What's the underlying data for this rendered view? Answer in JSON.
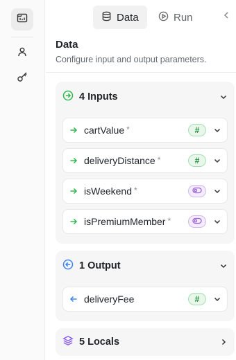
{
  "rail": {
    "items": [
      {
        "icon": "workflow-icon"
      },
      {
        "icon": "user-icon"
      },
      {
        "icon": "key-icon"
      }
    ]
  },
  "tabs": [
    {
      "label": "Data",
      "icon": "database-icon",
      "active": true
    },
    {
      "label": "Run",
      "icon": "play-icon",
      "active": false
    }
  ],
  "section": {
    "title": "Data",
    "description": "Configure input and output parameters."
  },
  "inputs": {
    "header": "4 Inputs",
    "items": [
      {
        "name": "cartValue",
        "required": "*",
        "type": "number"
      },
      {
        "name": "deliveryDistance",
        "required": "*",
        "type": "number"
      },
      {
        "name": "isWeekend",
        "required": "*",
        "type": "boolean"
      },
      {
        "name": "isPremiumMember",
        "required": "*",
        "type": "boolean"
      }
    ]
  },
  "outputs": {
    "header": "1 Output",
    "items": [
      {
        "name": "deliveryFee",
        "type": "number"
      }
    ]
  },
  "locals": {
    "header": "5 Locals"
  },
  "badges": {
    "number_symbol": "#"
  },
  "colors": {
    "input_accent": "#2fb84f",
    "output_accent": "#3b82f6",
    "locals_accent": "#8b5cf6",
    "boolean_badge": "#9b5fd6"
  }
}
